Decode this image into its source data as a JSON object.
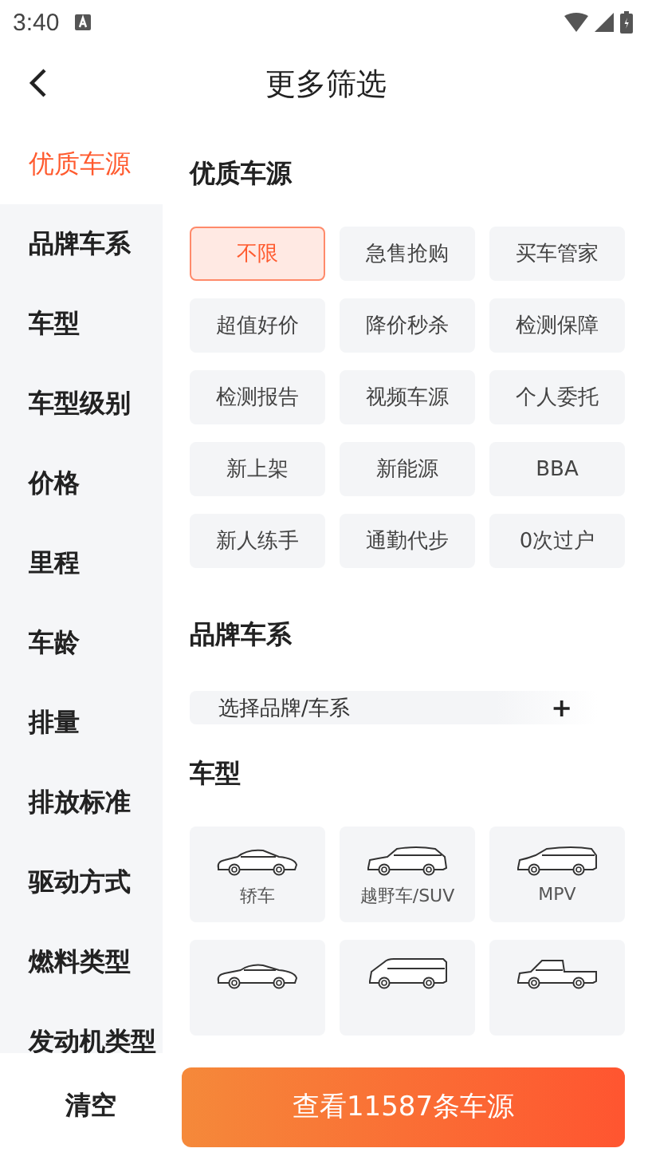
{
  "status_bar": {
    "time": "3:40"
  },
  "header": {
    "title": "更多筛选"
  },
  "sidebar": {
    "items": [
      {
        "label": "优质车源",
        "selected": true
      },
      {
        "label": "品牌车系",
        "selected": false
      },
      {
        "label": "车型",
        "selected": false
      },
      {
        "label": "车型级别",
        "selected": false
      },
      {
        "label": "价格",
        "selected": false
      },
      {
        "label": "里程",
        "selected": false
      },
      {
        "label": "车龄",
        "selected": false
      },
      {
        "label": "排量",
        "selected": false
      },
      {
        "label": "排放标准",
        "selected": false
      },
      {
        "label": "驱动方式",
        "selected": false
      },
      {
        "label": "燃料类型",
        "selected": false
      },
      {
        "label": "发动机类型",
        "selected": false
      }
    ]
  },
  "sections": [
    {
      "kind": "chips",
      "title": "优质车源",
      "options": [
        {
          "label": "不限",
          "selected": true
        },
        {
          "label": "急售抢购",
          "selected": false
        },
        {
          "label": "买车管家",
          "selected": false
        },
        {
          "label": "超值好价",
          "selected": false
        },
        {
          "label": "降价秒杀",
          "selected": false
        },
        {
          "label": "检测保障",
          "selected": false
        },
        {
          "label": "检测报告",
          "selected": false
        },
        {
          "label": "视频车源",
          "selected": false
        },
        {
          "label": "个人委托",
          "selected": false
        },
        {
          "label": "新上架",
          "selected": false
        },
        {
          "label": "新能源",
          "selected": false
        },
        {
          "label": "BBA",
          "selected": false
        },
        {
          "label": "新人练手",
          "selected": false
        },
        {
          "label": "通勤代步",
          "selected": false
        },
        {
          "label": "0次过户",
          "selected": false
        }
      ]
    },
    {
      "kind": "picker",
      "title": "品牌车系",
      "label": "选择品牌/车系",
      "action": "+"
    },
    {
      "kind": "cars",
      "title": "车型",
      "options": [
        {
          "label": "轿车",
          "kind": "sedan"
        },
        {
          "label": "越野车/SUV",
          "kind": "suv"
        },
        {
          "label": "MPV",
          "kind": "mpv"
        },
        {
          "kind": "coupe"
        },
        {
          "kind": "van"
        },
        {
          "kind": "pickup"
        }
      ]
    }
  ],
  "footer": {
    "clear": "清空",
    "submit": "查看11587条车源"
  }
}
